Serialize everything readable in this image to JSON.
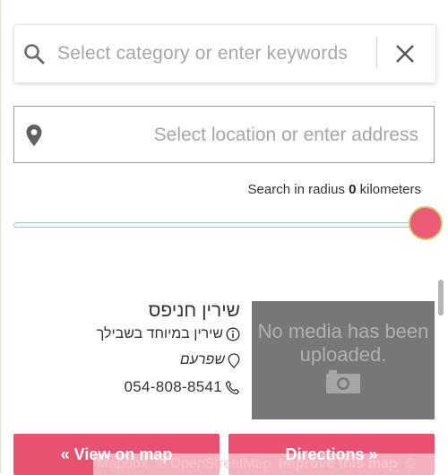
{
  "search": {
    "placeholder": "Select category or enter keywords",
    "clear_icon": "close-icon"
  },
  "location": {
    "placeholder": "Select location or enter address",
    "icon": "map-pin-icon"
  },
  "radius": {
    "prefix": "Search in radius",
    "value": "0",
    "suffix": "kilometers",
    "slider_fraction": 1.0
  },
  "listing": {
    "title": "שירין חניפס",
    "description": "שירין במיוחד בשבילך",
    "location": "שפרעם",
    "phone": "054-808-8541",
    "media_placeholder": "No media has been uploaded."
  },
  "buttons": {
    "view_on_map": "« View on map",
    "directions": "Directions »"
  },
  "attribution": {
    "mapbox": "Mapbox",
    "osm": "© OpenStreetMap",
    "improve": "Improve this map",
    "copyright": "©"
  },
  "colors": {
    "accent": "#e8516f",
    "thumb": "#ec5a76",
    "placeholder_text": "#a6a6a6",
    "media_bg": "#777777"
  }
}
